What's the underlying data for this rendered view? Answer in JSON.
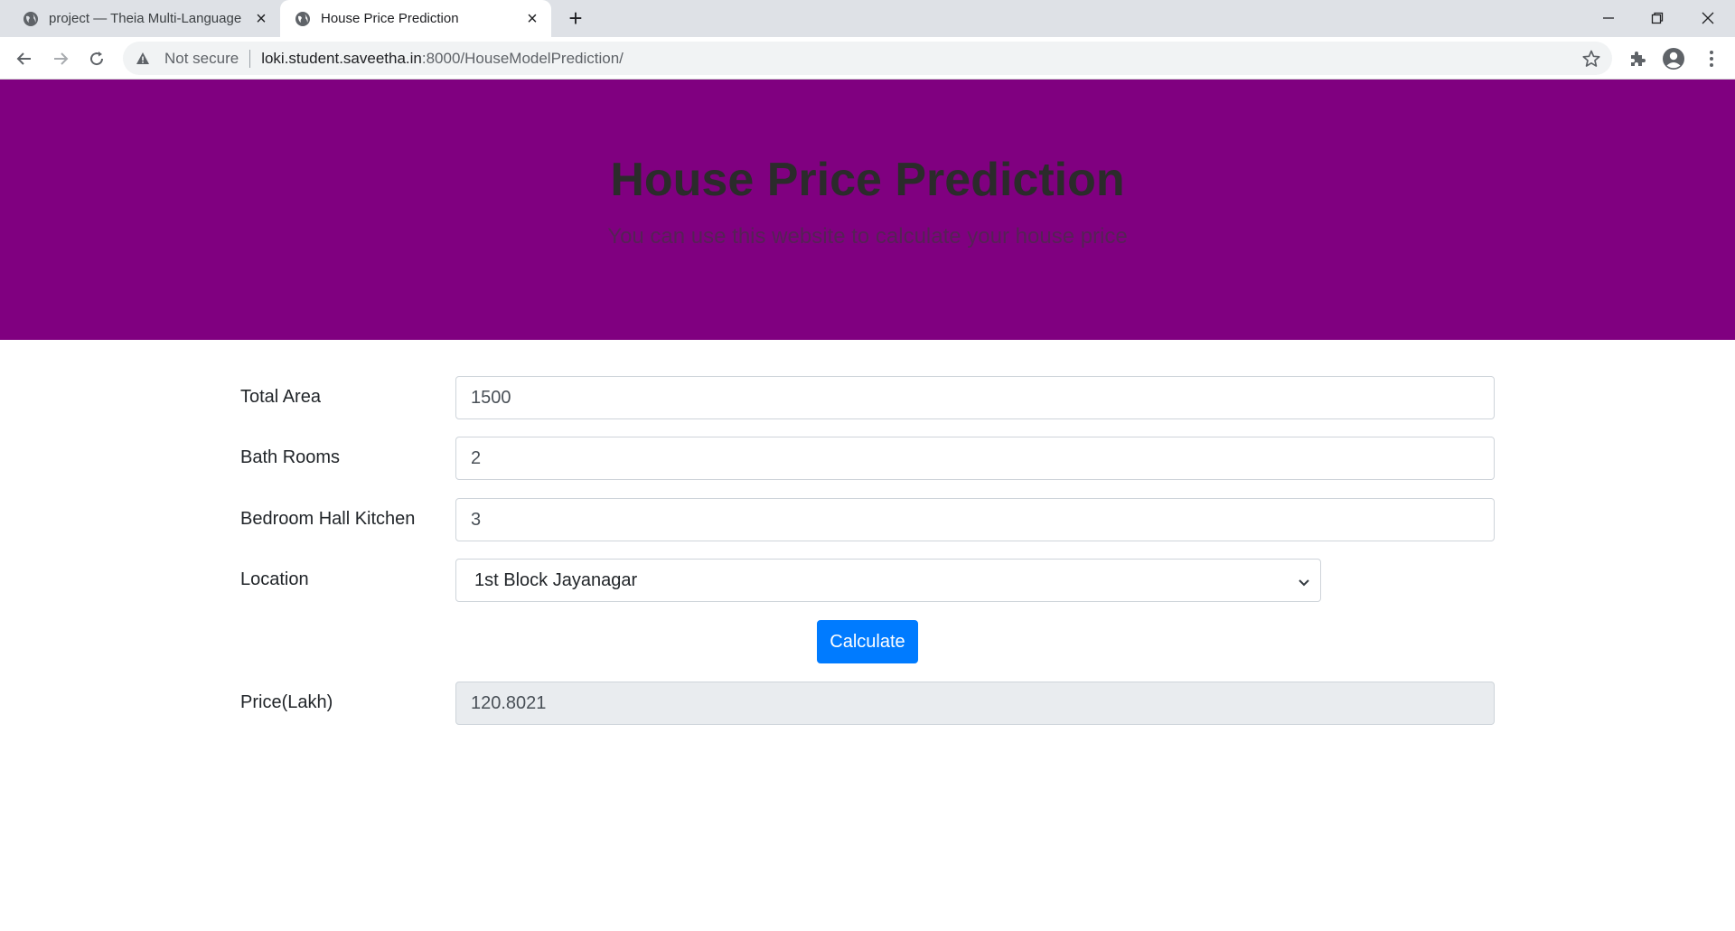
{
  "browser": {
    "tabs": [
      {
        "title": "project — Theia Multi-Language",
        "active": false
      },
      {
        "title": "House Price Prediction",
        "active": true
      }
    ],
    "new_tab_glyph": "+",
    "security_label": "Not secure",
    "url_host": "loki.student.saveetha.in",
    "url_path": ":8000/HouseModelPrediction/"
  },
  "hero": {
    "title": "House Price Prediction",
    "subtitle": "You can use this website to calculate your house price",
    "background": "#800080"
  },
  "form": {
    "total_area": {
      "label": "Total Area",
      "value": "1500"
    },
    "bath_rooms": {
      "label": "Bath Rooms",
      "value": "2"
    },
    "bhk": {
      "label": "Bedroom Hall Kitchen",
      "value": "3"
    },
    "location": {
      "label": "Location",
      "selected": "1st Block Jayanagar"
    },
    "calculate_label": "Calculate",
    "price": {
      "label": "Price(Lakh)",
      "value": "120.8021"
    }
  },
  "colors": {
    "primary_button": "#007bff",
    "hero_background": "#800080"
  }
}
